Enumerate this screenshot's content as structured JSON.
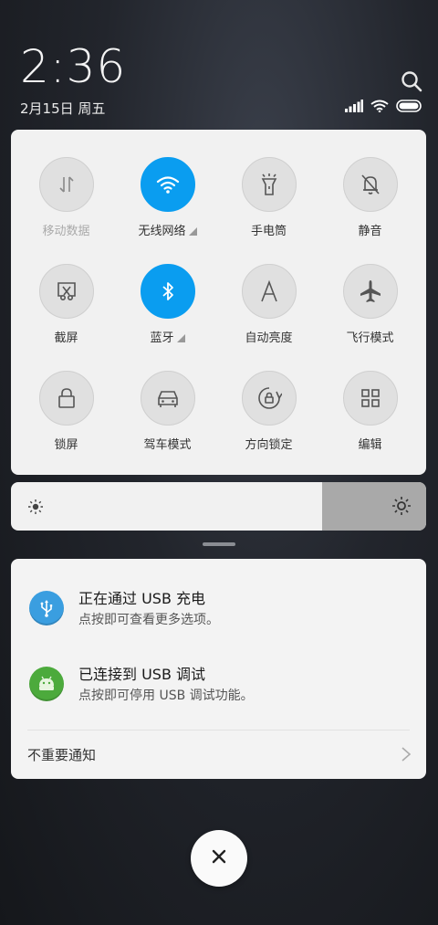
{
  "status": {
    "time": "2:36",
    "date": "2月15日 周五"
  },
  "tiles": [
    {
      "label": "移动数据",
      "icon": "mobile-data-icon",
      "on": false,
      "disabled": true,
      "expand": false
    },
    {
      "label": "无线网络",
      "icon": "wifi-icon",
      "on": true,
      "disabled": false,
      "expand": true
    },
    {
      "label": "手电筒",
      "icon": "flashlight-icon",
      "on": false,
      "disabled": false,
      "expand": false
    },
    {
      "label": "静音",
      "icon": "mute-bell-icon",
      "on": false,
      "disabled": false,
      "expand": false
    },
    {
      "label": "截屏",
      "icon": "screenshot-icon",
      "on": false,
      "disabled": false,
      "expand": false
    },
    {
      "label": "蓝牙",
      "icon": "bluetooth-icon",
      "on": true,
      "disabled": false,
      "expand": true
    },
    {
      "label": "自动亮度",
      "icon": "auto-brightness-icon",
      "on": false,
      "disabled": false,
      "expand": false
    },
    {
      "label": "飞行模式",
      "icon": "airplane-icon",
      "on": false,
      "disabled": false,
      "expand": false
    },
    {
      "label": "锁屏",
      "icon": "lock-icon",
      "on": false,
      "disabled": false,
      "expand": false
    },
    {
      "label": "驾车模式",
      "icon": "car-icon",
      "on": false,
      "disabled": false,
      "expand": false
    },
    {
      "label": "方向锁定",
      "icon": "rotation-lock-icon",
      "on": false,
      "disabled": false,
      "expand": false
    },
    {
      "label": "编辑",
      "icon": "edit-grid-icon",
      "on": false,
      "disabled": false,
      "expand": false
    }
  ],
  "brightness": {
    "level": 0.75
  },
  "notifications": [
    {
      "title": "正在通过  USB  充电",
      "subtitle": "点按即可查看更多选项。",
      "icon": "usb-icon",
      "color": "#3a9ee0"
    },
    {
      "title": "已连接到  USB  调试",
      "subtitle": "点按即可停用 USB 调试功能。",
      "icon": "android-icon",
      "color": "#4caa3c"
    }
  ],
  "unimportant_label": "不重要通知",
  "colors": {
    "accent": "#0a9df0",
    "panel": "#f1f1f1"
  }
}
